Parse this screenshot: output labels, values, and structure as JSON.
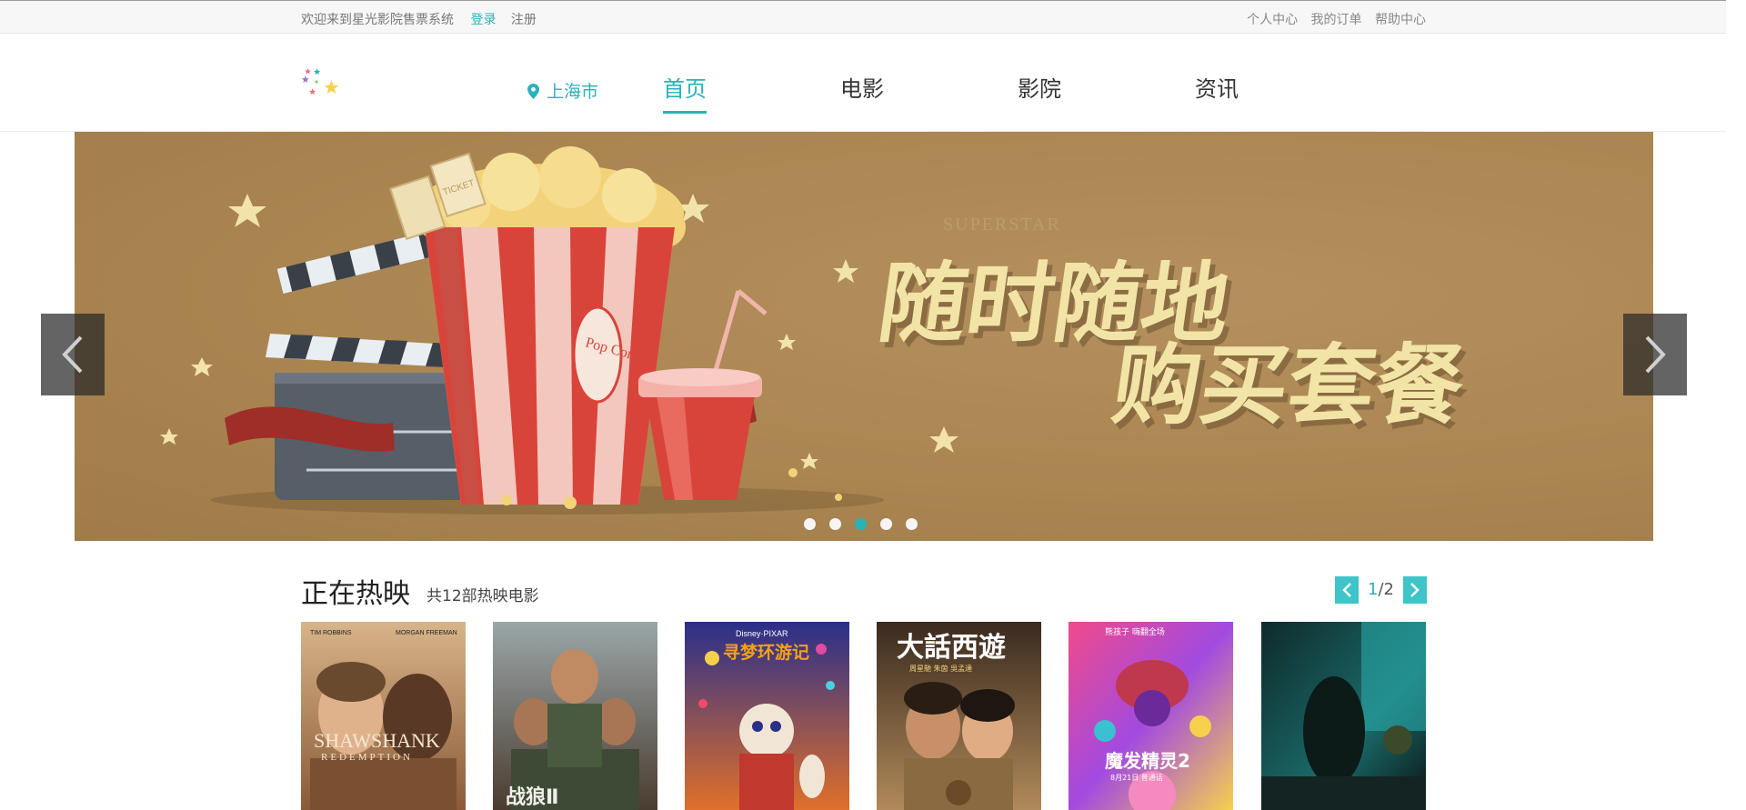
{
  "topbar": {
    "welcome": "欢迎来到星光影院售票系统",
    "login": "登录",
    "register": "注册",
    "links": [
      "个人中心",
      "我的订单",
      "帮助中心"
    ]
  },
  "header": {
    "city": "上海市",
    "nav": [
      "首页",
      "电影",
      "影院",
      "资讯"
    ],
    "active_nav": "首页"
  },
  "banner": {
    "headline_line1": "随时随地",
    "headline_line2": "购买套餐",
    "popcorn_text": "Pop Corn",
    "ticket_text": "TICKET",
    "watermark": "SUPERSTAR",
    "slide_count": 5,
    "active_slide": 3
  },
  "hot": {
    "title": "正在热映",
    "count_text": "共12部热映电影",
    "page_current": "1",
    "page_sep_total": "/2"
  },
  "posters": [
    {
      "top_left": "TIM ROBBINS",
      "top_right": "MORGAN FREEMAN",
      "title": "SHAWSHANK",
      "sub": "REDEMPTION"
    },
    {
      "title": "战狼Ⅱ"
    },
    {
      "brand": "Disney·PIXAR",
      "title": "寻梦环游记"
    },
    {
      "title": "大話西遊",
      "sub": "周星馳 朱茵 吳孟達"
    },
    {
      "top": "熊孩子 嗨翻全场",
      "title": "魔发精灵2",
      "sub": "8月21日 普通话"
    },
    {
      "title": ""
    }
  ],
  "colors": {
    "accent": "#2ab2b8",
    "banner_bg": "#a9844f",
    "headline": "#f2e4a6"
  }
}
